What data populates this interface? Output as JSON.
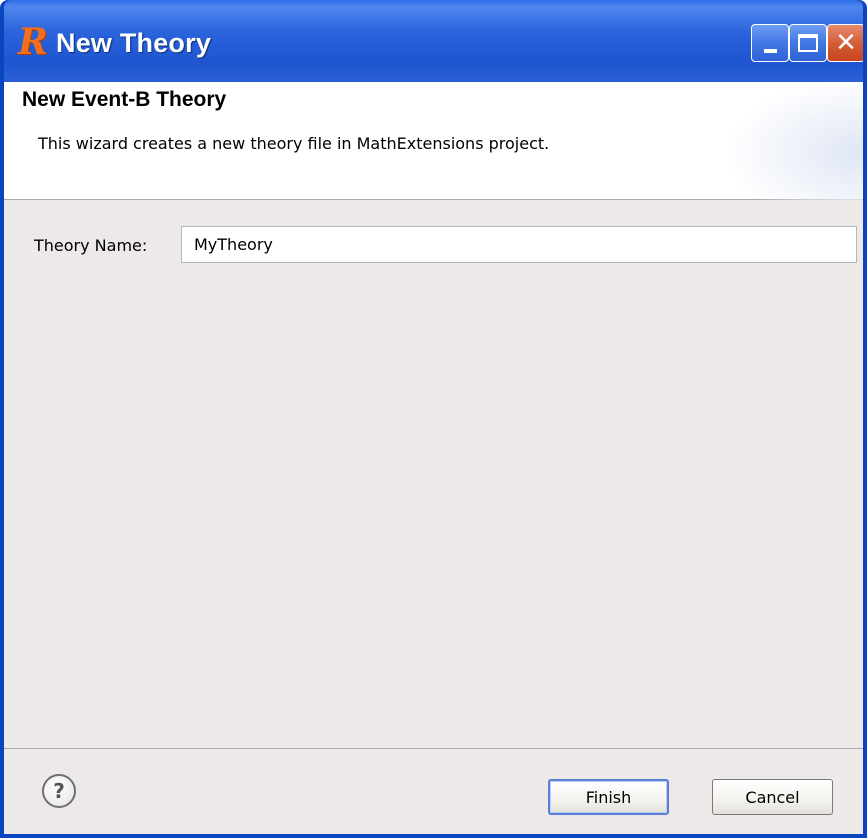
{
  "window": {
    "title": "New Theory",
    "app_icon": "rodin-icon",
    "controls": {
      "minimize": "minimize",
      "maximize": "maximize",
      "close": "✕"
    }
  },
  "banner": {
    "title": "New Event-B Theory",
    "description": "This wizard creates a new theory file in MathExtensions project."
  },
  "form": {
    "theory_name_label": "Theory Name:",
    "theory_name_value": "MyTheory"
  },
  "footer": {
    "help_glyph": "?",
    "finish_label": "Finish",
    "cancel_label": "Cancel"
  },
  "colors": {
    "titlebar": "#2b63dc",
    "dialog_background": "#ece9e8",
    "banner_background": "#ffffff",
    "close_button": "#d35a35",
    "icon_orange": "#f26f1e"
  }
}
